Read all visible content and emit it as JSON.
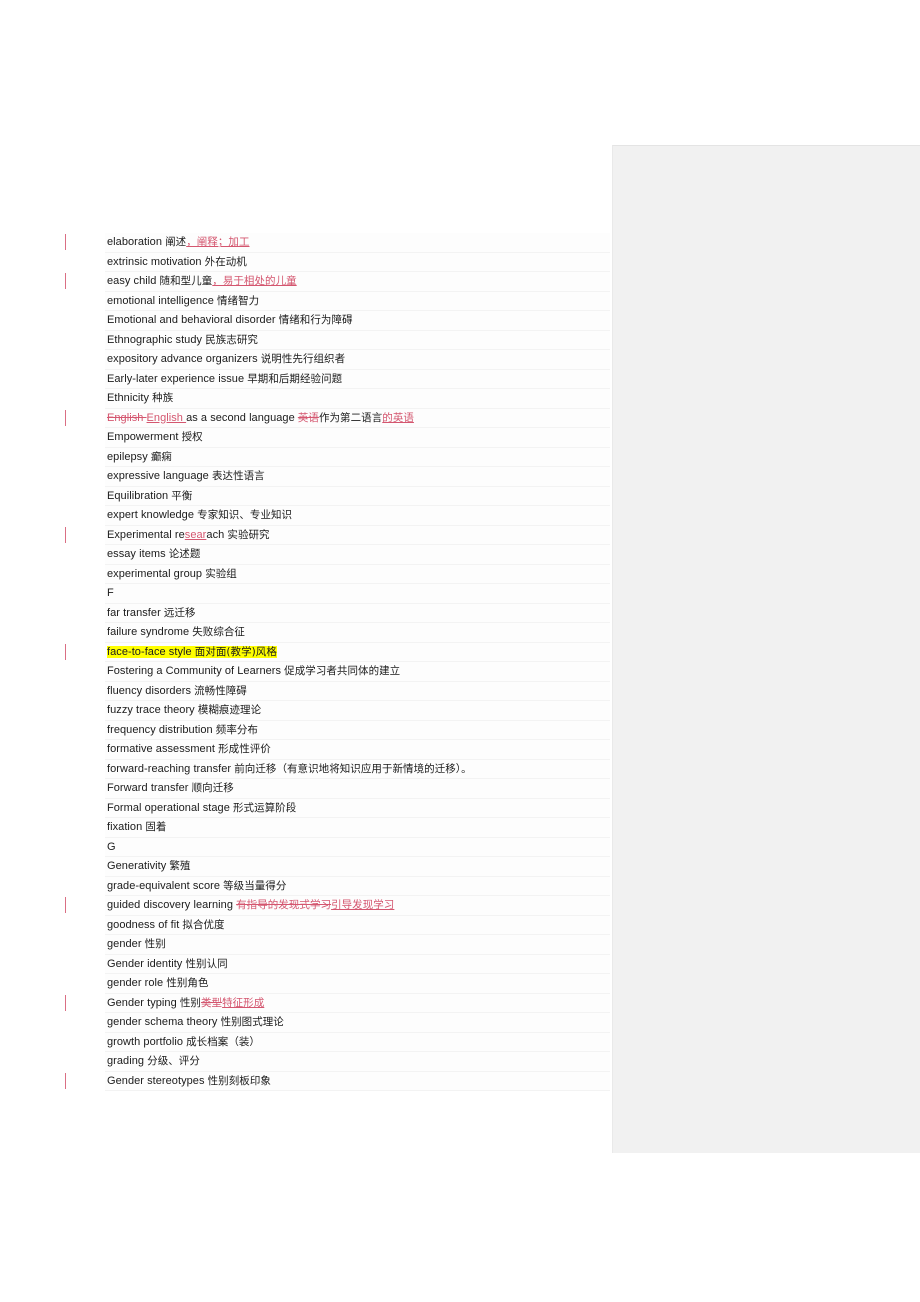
{
  "document": {
    "type": "word-processor-page",
    "page_background": "#ffffff",
    "review_pane_color": "#f1f1f1",
    "insertion_color": "#d4566f",
    "deletion_color": "#d4566f",
    "highlight_color": "#ffff00",
    "change_bar_color": "#d4566f"
  },
  "glossary": {
    "rows": [
      {
        "id": "elaboration",
        "changed": true,
        "wide": false,
        "runs": [
          {
            "t": "elaboration ",
            "s": "en"
          },
          {
            "t": "阐述",
            "s": "cn"
          },
          {
            "t": "，阐释；加工",
            "s": "cn-ins"
          }
        ]
      },
      {
        "id": "extrinsic-motivation",
        "changed": false,
        "wide": false,
        "runs": [
          {
            "t": "extrinsic motivation ",
            "s": "en"
          },
          {
            "t": "外在动机",
            "s": "cn"
          }
        ]
      },
      {
        "id": "easy-child",
        "changed": true,
        "wide": false,
        "runs": [
          {
            "t": "easy child  ",
            "s": "en"
          },
          {
            "t": "随和型儿童",
            "s": "cn"
          },
          {
            "t": "，易于相处的儿童",
            "s": "cn-ins"
          }
        ]
      },
      {
        "id": "emotional-intelligence",
        "changed": false,
        "wide": false,
        "runs": [
          {
            "t": "emotional intelligence  ",
            "s": "en"
          },
          {
            "t": "情绪智力",
            "s": "cn"
          }
        ]
      },
      {
        "id": "emotional-and-behavioral-disorder",
        "changed": false,
        "wide": false,
        "runs": [
          {
            "t": "Emotional",
            "s": "en"
          },
          {
            "t": "   ",
            "s": "gap"
          },
          {
            "t": "and behavioral disorder  ",
            "s": "en"
          },
          {
            "t": "情绪和行为障碍",
            "s": "cn"
          }
        ]
      },
      {
        "id": "ethnographic-study",
        "changed": false,
        "wide": false,
        "runs": [
          {
            "t": "Ethnographic study  ",
            "s": "en"
          },
          {
            "t": "民族志研究",
            "s": "cn"
          }
        ]
      },
      {
        "id": "expository-advance-organizers",
        "changed": false,
        "wide": false,
        "runs": [
          {
            "t": "expository advance organizers ",
            "s": "en"
          },
          {
            "t": "说明性先行组织者",
            "s": "cn"
          }
        ]
      },
      {
        "id": "early-later-experience-issue",
        "changed": false,
        "wide": false,
        "runs": [
          {
            "t": "Early-later experience issue  ",
            "s": "en"
          },
          {
            "t": "早期和后期经验问题",
            "s": "cn"
          }
        ]
      },
      {
        "id": "ethnicity",
        "changed": false,
        "wide": false,
        "runs": [
          {
            "t": "Ethnicity  ",
            "s": "en"
          },
          {
            "t": "种族",
            "s": "cn"
          }
        ]
      },
      {
        "id": "english-as-a-second-language",
        "changed": true,
        "wide": false,
        "runs": [
          {
            "t": "English ",
            "s": "en-del"
          },
          {
            "t": "  ",
            "s": "gap"
          },
          {
            "t": "English ",
            "s": "en-ins"
          },
          {
            "t": "as a second language ",
            "s": "en"
          },
          {
            "t": "英语",
            "s": "cn-del"
          },
          {
            "t": "作为第二语言",
            "s": "cn"
          },
          {
            "t": "的英语",
            "s": "cn-ins"
          }
        ]
      },
      {
        "id": "empowerment",
        "changed": false,
        "wide": false,
        "runs": [
          {
            "t": "Empowerment  ",
            "s": "en"
          },
          {
            "t": "授权",
            "s": "cn"
          }
        ]
      },
      {
        "id": "epilepsy",
        "changed": false,
        "wide": false,
        "runs": [
          {
            "t": "epilepsy  ",
            "s": "en"
          },
          {
            "t": "癫痫",
            "s": "cn"
          }
        ]
      },
      {
        "id": "expressive-language",
        "changed": false,
        "wide": false,
        "runs": [
          {
            "t": "expressive language ",
            "s": "en"
          },
          {
            "t": "表达性语言",
            "s": "cn"
          }
        ]
      },
      {
        "id": "equilibration",
        "changed": false,
        "wide": false,
        "runs": [
          {
            "t": "Equilibration  ",
            "s": "en"
          },
          {
            "t": "平衡",
            "s": "cn"
          }
        ]
      },
      {
        "id": "expert-knowledge",
        "changed": false,
        "wide": false,
        "runs": [
          {
            "t": "expert knowledge ",
            "s": "en"
          },
          {
            "t": "专家知识、专业知识",
            "s": "cn"
          }
        ]
      },
      {
        "id": "experimental-research",
        "changed": true,
        "wide": false,
        "runs": [
          {
            "t": "Experimental re",
            "s": "en"
          },
          {
            "t": "sear",
            "s": "en-ins"
          },
          {
            "t": "ach  ",
            "s": "en"
          },
          {
            "t": "实验研究",
            "s": "cn"
          }
        ]
      },
      {
        "id": "essay-items",
        "changed": false,
        "wide": false,
        "runs": [
          {
            "t": "essay items ",
            "s": "en"
          },
          {
            "t": "论述题",
            "s": "cn"
          }
        ]
      },
      {
        "id": "experimental-group",
        "changed": false,
        "wide": false,
        "runs": [
          {
            "t": "experimental group  ",
            "s": "en"
          },
          {
            "t": "实验组",
            "s": "cn"
          }
        ]
      },
      {
        "id": "section-f",
        "changed": false,
        "wide": false,
        "section": true,
        "runs": [
          {
            "t": "        ",
            "s": "gap"
          },
          {
            "t": "F",
            "s": "en"
          }
        ]
      },
      {
        "id": "far-transfer",
        "changed": false,
        "wide": false,
        "runs": [
          {
            "t": "far transfer ",
            "s": "en"
          },
          {
            "t": "远迁移",
            "s": "cn"
          }
        ]
      },
      {
        "id": "failure-syndrome",
        "changed": false,
        "wide": false,
        "runs": [
          {
            "t": "failure syndrome ",
            "s": "en"
          },
          {
            "t": "失败综合征",
            "s": "cn"
          }
        ]
      },
      {
        "id": "face-to-face-style",
        "changed": true,
        "wide": false,
        "highlighted": true,
        "runs": [
          {
            "t": "face-to-face style ",
            "s": "en-hl"
          },
          {
            "t": "   ",
            "s": "gap-hl"
          },
          {
            "t": "面对面(教学)风格",
            "s": "cn-hl"
          }
        ]
      },
      {
        "id": "fostering-a-community-of-learners",
        "changed": false,
        "wide": false,
        "runs": [
          {
            "t": "Fostering a Community of Learners  ",
            "s": "en"
          },
          {
            "t": "促成学习者共同体的建立",
            "s": "cn"
          }
        ]
      },
      {
        "id": "fluency-disorders",
        "changed": false,
        "wide": false,
        "runs": [
          {
            "t": "fluency disorders ",
            "s": "en"
          },
          {
            "t": "流畅性障碍",
            "s": "cn"
          }
        ]
      },
      {
        "id": "fuzzy-trace-theory",
        "changed": false,
        "wide": false,
        "runs": [
          {
            "t": "fuzzy trace theory ",
            "s": "en"
          },
          {
            "t": "模糊痕迹理论",
            "s": "cn"
          }
        ]
      },
      {
        "id": "frequency-distribution",
        "changed": false,
        "wide": false,
        "runs": [
          {
            "t": "frequency distribution ",
            "s": "en"
          },
          {
            "t": "频率分布",
            "s": "cn"
          }
        ]
      },
      {
        "id": "formative-assessment",
        "changed": false,
        "wide": false,
        "runs": [
          {
            "t": "formative assessment ",
            "s": "en"
          },
          {
            "t": "形成性评价",
            "s": "cn"
          }
        ]
      },
      {
        "id": "forward-reaching-transfer",
        "changed": false,
        "wide": true,
        "runs": [
          {
            "t": "forward-reaching transfer ",
            "s": "en"
          },
          {
            "t": "前向迁移（有意识地将知识应用于新情境的迁移）。",
            "s": "cn"
          }
        ]
      },
      {
        "id": "forward-transfer",
        "changed": false,
        "wide": false,
        "runs": [
          {
            "t": "Forward",
            "s": "en"
          },
          {
            "t": "   ",
            "s": "gap"
          },
          {
            "t": "transfer  ",
            "s": "en"
          },
          {
            "t": "顺向迁移",
            "s": "cn"
          }
        ]
      },
      {
        "id": "formal-operational-stage",
        "changed": false,
        "wide": false,
        "runs": [
          {
            "t": "Formal operational stage  ",
            "s": "en"
          },
          {
            "t": "形式运算阶段",
            "s": "cn"
          }
        ]
      },
      {
        "id": "fixation",
        "changed": false,
        "wide": false,
        "runs": [
          {
            "t": "fixation ",
            "s": "en"
          },
          {
            "t": "固着",
            "s": "cn"
          }
        ]
      },
      {
        "id": "section-g",
        "changed": false,
        "wide": false,
        "section": true,
        "runs": [
          {
            "t": "     ",
            "s": "gap"
          },
          {
            "t": "G",
            "s": "en"
          }
        ]
      },
      {
        "id": "generativity",
        "changed": false,
        "wide": false,
        "runs": [
          {
            "t": "Generativity  ",
            "s": "en"
          },
          {
            "t": "繁殖",
            "s": "cn"
          }
        ]
      },
      {
        "id": "grade-equivalent-score",
        "changed": false,
        "wide": false,
        "runs": [
          {
            "t": "grade-equivalent score ",
            "s": "en"
          },
          {
            "t": "等级当量得分",
            "s": "cn"
          }
        ]
      },
      {
        "id": "guided-discovery-learning",
        "changed": true,
        "wide": false,
        "runs": [
          {
            "t": "guided discovery learning ",
            "s": "en"
          },
          {
            "t": "有指导的发现式学习",
            "s": "cn-del"
          },
          {
            "t": "引导发现学习",
            "s": "cn-ins"
          }
        ]
      },
      {
        "id": "goodness-of-fit",
        "changed": false,
        "wide": false,
        "runs": [
          {
            "t": "goodness of fit ",
            "s": "en"
          },
          {
            "t": "拟合优度",
            "s": "cn"
          }
        ]
      },
      {
        "id": "gender",
        "changed": false,
        "wide": false,
        "runs": [
          {
            "t": "gender  ",
            "s": "en"
          },
          {
            "t": "性别",
            "s": "cn"
          }
        ]
      },
      {
        "id": "gender-identity",
        "changed": false,
        "wide": false,
        "runs": [
          {
            "t": "Gender identity  ",
            "s": "en"
          },
          {
            "t": "性别认同",
            "s": "cn"
          }
        ]
      },
      {
        "id": "gender-role",
        "changed": false,
        "wide": false,
        "runs": [
          {
            "t": "gender role  ",
            "s": "en"
          },
          {
            "t": "性别角色",
            "s": "cn"
          }
        ]
      },
      {
        "id": "gender-typing",
        "changed": true,
        "wide": false,
        "runs": [
          {
            "t": "Gender typing  ",
            "s": "en"
          },
          {
            "t": "性别",
            "s": "cn"
          },
          {
            "t": "类型",
            "s": "cn-del"
          },
          {
            "t": "特征形成",
            "s": "cn-ins"
          }
        ]
      },
      {
        "id": "gender-schema-theory",
        "changed": false,
        "wide": false,
        "runs": [
          {
            "t": "gender schema theory  ",
            "s": "en"
          },
          {
            "t": "性别图式理论",
            "s": "cn"
          }
        ]
      },
      {
        "id": "growth-portfolio",
        "changed": false,
        "wide": false,
        "runs": [
          {
            "t": "growth portfolio ",
            "s": "en"
          },
          {
            "t": "成长档案（装）",
            "s": "cn"
          }
        ]
      },
      {
        "id": "grading",
        "changed": false,
        "wide": false,
        "runs": [
          {
            "t": "grading ",
            "s": "en"
          },
          {
            "t": "分级、评分",
            "s": "cn"
          }
        ]
      },
      {
        "id": "gender-stereotypes",
        "changed": true,
        "wide": false,
        "runs": [
          {
            "t": "Gender stereotypes  ",
            "s": "en"
          },
          {
            "t": "性别刻板印象",
            "s": "cn"
          }
        ]
      }
    ]
  }
}
